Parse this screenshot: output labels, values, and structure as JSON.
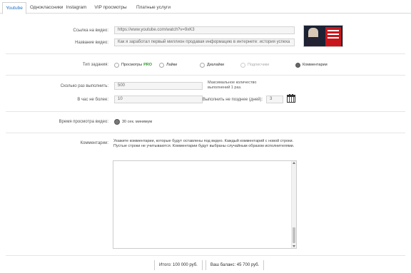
{
  "tabs": [
    "Youtube",
    "Одноклассники",
    "Instagram",
    "VIP просмотры",
    "Платные услуги"
  ],
  "video": {
    "link_label": "Ссылка на видео:",
    "link_value": "https://www.youtube.com/watch?v=9xK3",
    "title_label": "Название видео:",
    "title_value": "Как я заработал первый миллион продавая информацию в интернете: история успеха"
  },
  "task_type": {
    "label": "Тип задания:",
    "options": [
      {
        "label": "Просмотры",
        "badge": "PRO",
        "checked": false,
        "disabled": false
      },
      {
        "label": "Лайки",
        "checked": false,
        "disabled": false
      },
      {
        "label": "Дизлайки",
        "checked": false,
        "disabled": false
      },
      {
        "label": "Подписчики",
        "checked": false,
        "disabled": true
      },
      {
        "label": "Комментарии",
        "checked": true,
        "disabled": false
      }
    ]
  },
  "execution": {
    "count_label": "Сколько раз выполнить:",
    "count_value": "500",
    "hint": "Максимальное количество выполнений 1 раз.",
    "per_hour_label": "В час не более:",
    "per_hour_value": "10",
    "max_days_label": "Выполнить не позднее (дней):",
    "max_days_value": "3"
  },
  "viewing": {
    "label": "Время просмотра видео:",
    "value": "30 сек. минимум"
  },
  "comments": {
    "label": "Комментарии:",
    "hint": "Укажите комментарии, которые будут оставлены под видео. Каждый комментарий с новой строки. Пустые строки не учитываются. Комментарии будут выбраны случайным образом исполнителями.",
    "value": ""
  },
  "totals": {
    "cost_text": "Итого: 100 000 руб.",
    "balance_text": "Ваш баланс: 45 700 руб."
  },
  "colors": {
    "accent": "#1a6fc4",
    "pro": "#2a9a2a"
  }
}
